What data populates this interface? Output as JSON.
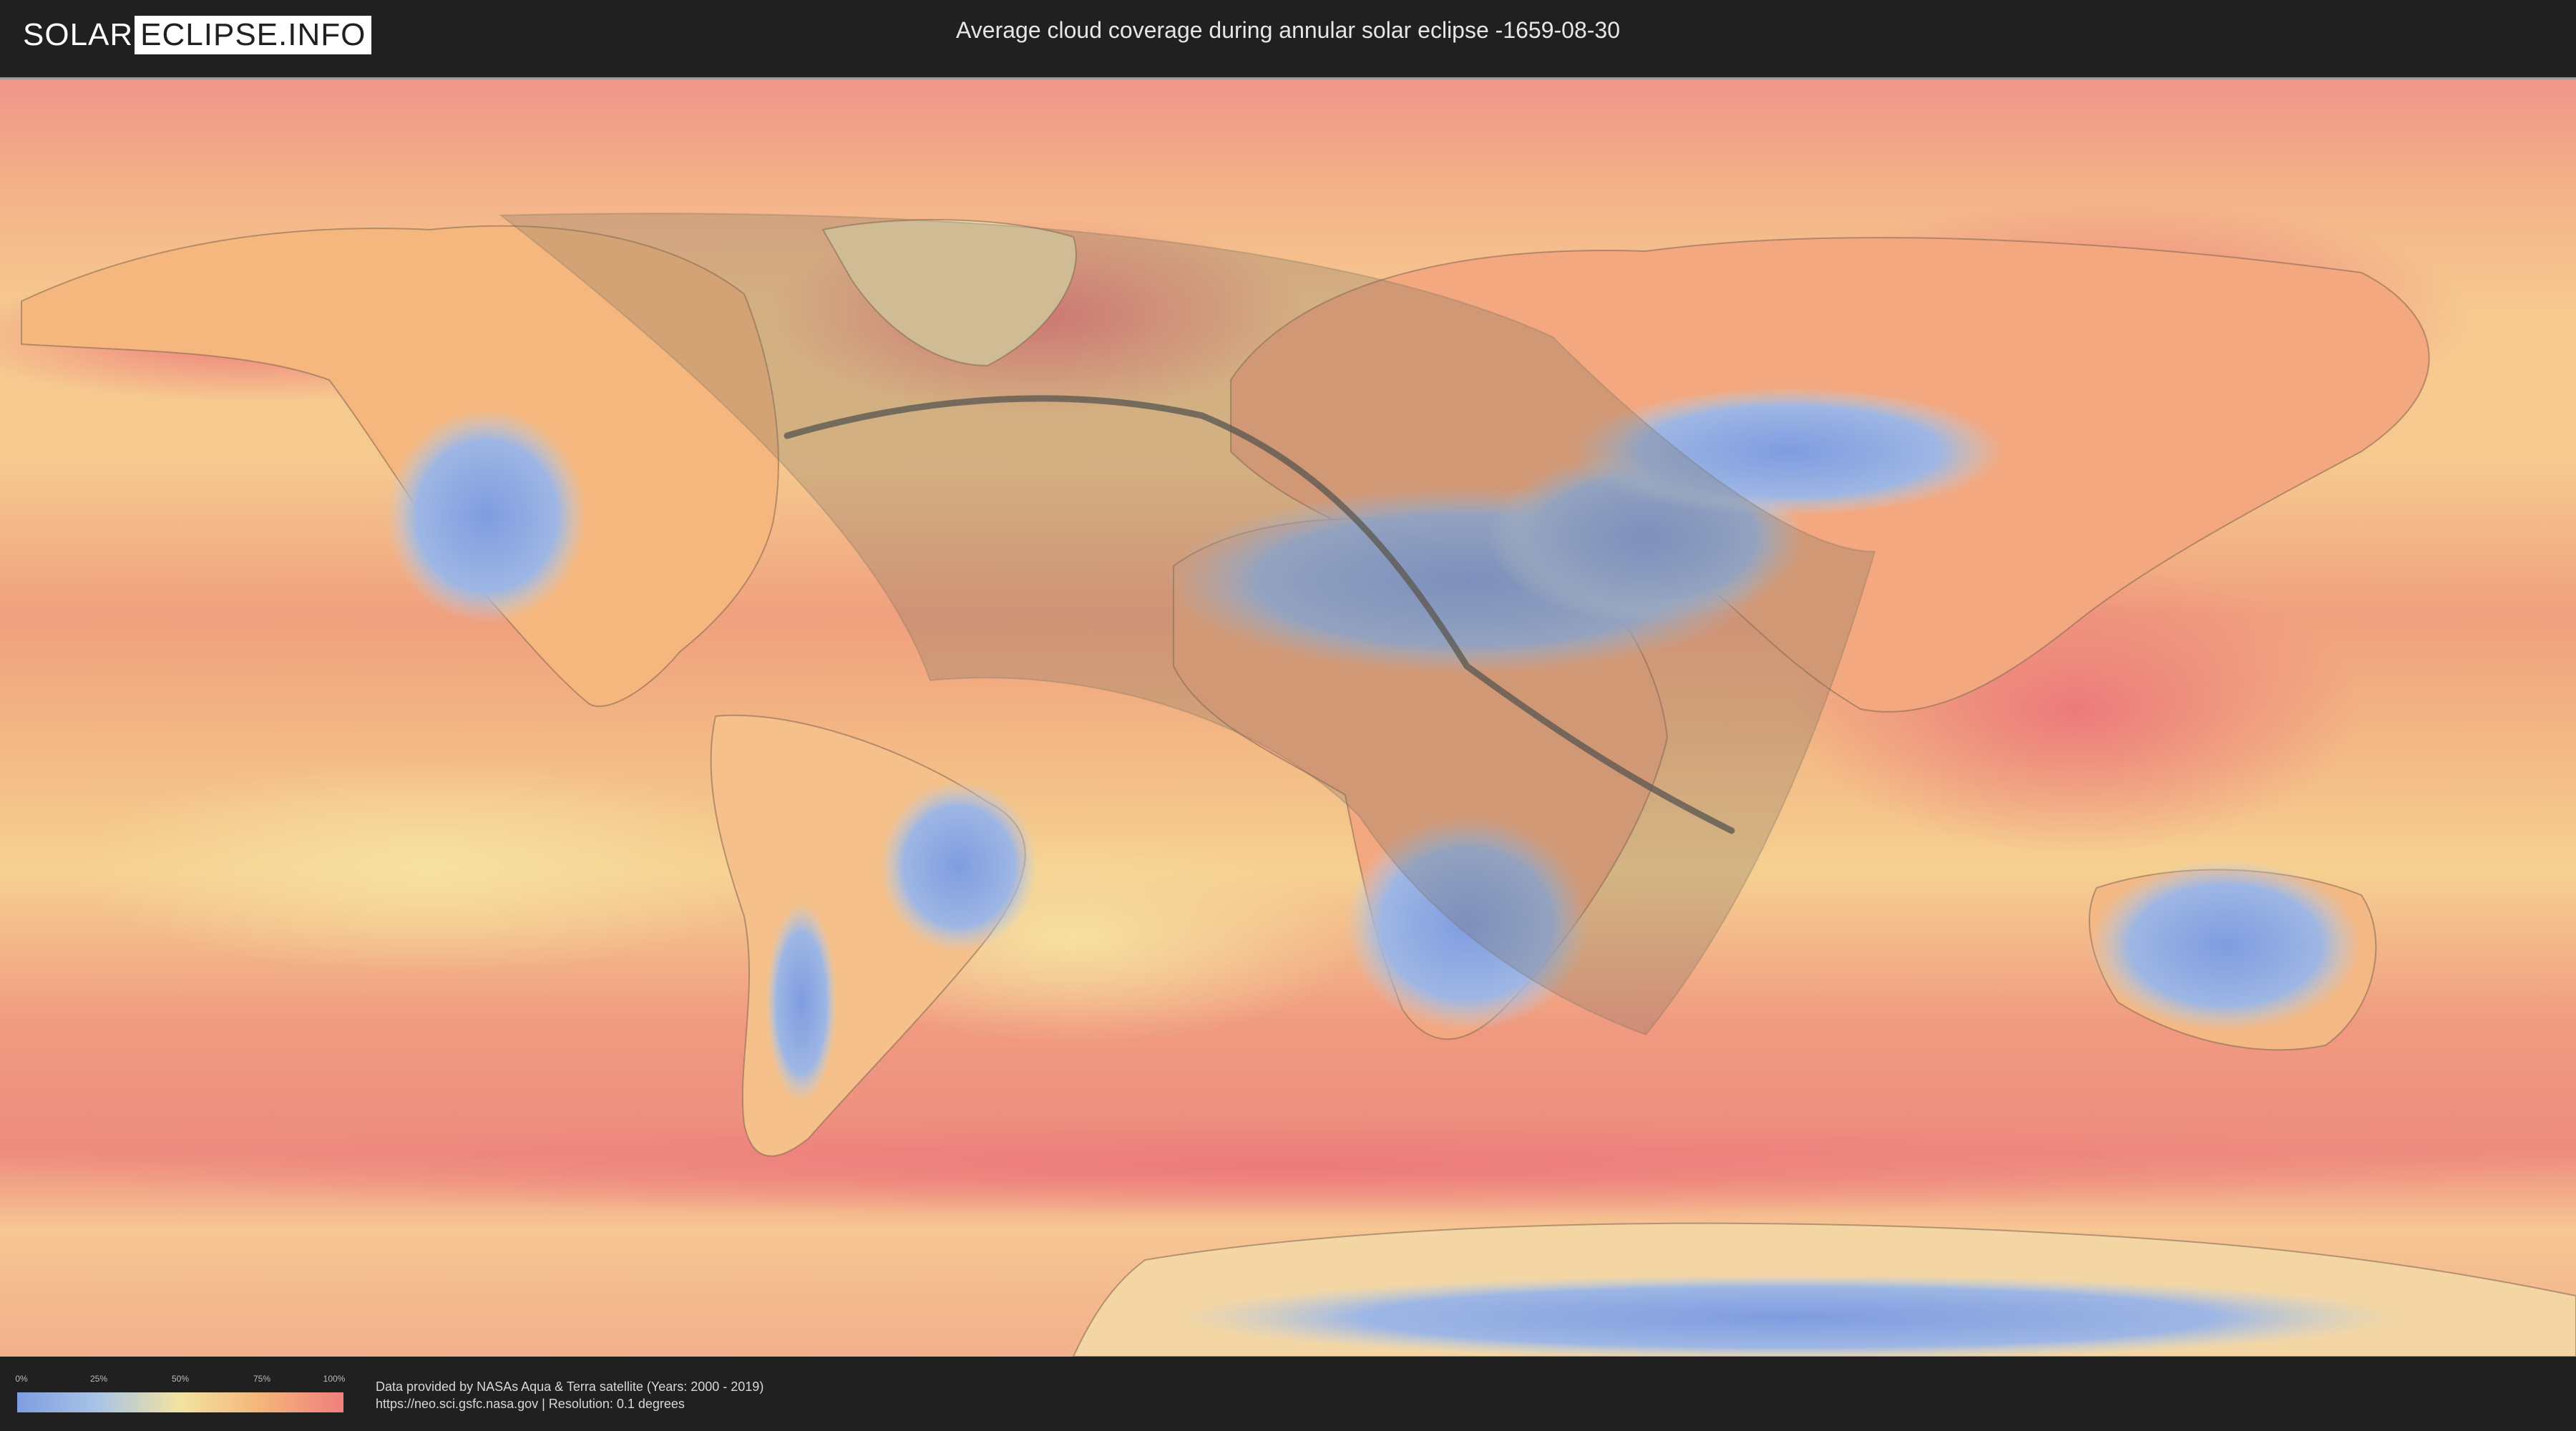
{
  "header": {
    "logo_part1": "SOLAR",
    "logo_part2": "ECLIPSE.INFO",
    "title": "Average cloud coverage during annular solar eclipse -1659-08-30"
  },
  "map": {
    "ocean_base_color": "#f3a57a",
    "high_cloud_color": "#ef7f7d",
    "mid_cloud_color": "#f7d490",
    "low_cloud_color": "#7f9ce0",
    "land_outline_color": "#8a6a55",
    "eclipse_shadow_fill": "#7a7060",
    "central_line_color": "#5e5a52"
  },
  "legend": {
    "ticks": [
      "0%",
      "25%",
      "50%",
      "75%",
      "100%"
    ],
    "colors": [
      "#7f9ce0",
      "#a9c4e6",
      "#f2e3a0",
      "#f5b47a",
      "#ef7f7d"
    ]
  },
  "footer": {
    "credit_line1": "Data provided by NASAs Aqua & Terra satellite (Years: 2000 - 2019)",
    "credit_line2": "https://neo.sci.gsfc.nasa.gov | Resolution: 0.1 degrees"
  }
}
